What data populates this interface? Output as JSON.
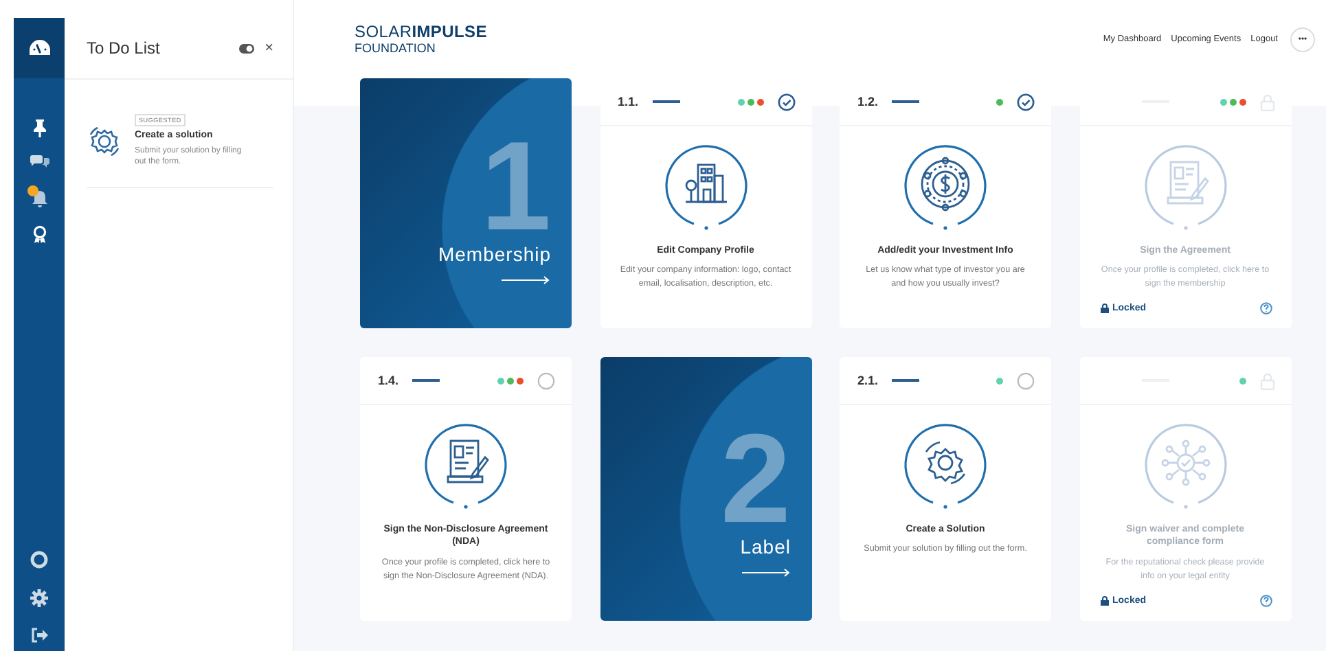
{
  "nav": {
    "top": [
      {
        "kind": "pin"
      },
      {
        "kind": "chat"
      },
      {
        "kind": "bell",
        "badge": true
      },
      {
        "kind": "award"
      }
    ],
    "bottom": [
      {
        "kind": "help"
      },
      {
        "kind": "settings"
      },
      {
        "kind": "logout"
      }
    ]
  },
  "todo": {
    "title": "To Do List",
    "close": "×",
    "items": [
      {
        "tag": "SUGGESTED",
        "title": "Create a solution",
        "description": "Submit your solution by filling out the form."
      }
    ]
  },
  "header": {
    "logo": "SOLAR**IMPULSE**",
    "logo_sub": "FOUNDATION",
    "links": [
      "My Dashboard",
      "Upcoming Events",
      "Logout"
    ],
    "more": "•••"
  },
  "cards": [
    {
      "kind": "section",
      "number": "1",
      "label": "Membership"
    },
    {
      "kind": "building",
      "number": "1.1.",
      "done": true,
      "locked": false,
      "dots": [
        {
          "color": "#5fd3b0"
        },
        {
          "color": "#4cbc5a"
        },
        {
          "color": "#e8502e"
        }
      ],
      "title": "Edit Company Profile",
      "description": "Edit your company information: logo, contact email, localisation, description, etc."
    },
    {
      "kind": "money",
      "number": "1.2.",
      "done": true,
      "locked": false,
      "dots": [
        {
          "color": "#4cbc5a"
        }
      ],
      "title": "Add/edit your Investment Info",
      "description": "Let us know what type of investor you are and how you usually invest?"
    },
    {
      "kind": "document",
      "locked": true,
      "dots": [
        {
          "color": "#5fd3b0"
        },
        {
          "color": "#4cbc5a"
        },
        {
          "color": "#e8502e"
        }
      ],
      "title": "Sign the Agreement",
      "description": "Once your profile is completed, click here to sign the membership",
      "footer": "Locked"
    },
    {
      "kind": "document",
      "number": "1.4.",
      "done": false,
      "locked": false,
      "dots": [
        {
          "color": "#5fd3b0"
        },
        {
          "color": "#4cbc5a"
        },
        {
          "color": "#e8502e"
        }
      ],
      "title": "Sign the Non-Disclosure Agreement (NDA)",
      "description": "Once your profile is completed, click here to sign the Non-Disclosure Agreement (NDA)."
    },
    {
      "kind": "section",
      "number": "2",
      "label": "Label"
    },
    {
      "kind": "gear",
      "number": "2.1.",
      "done": false,
      "locked": false,
      "dots": [
        {
          "color": "#5fd3b0"
        }
      ],
      "title": "Create a Solution",
      "description": "Submit your solution by filling out the form."
    },
    {
      "kind": "network",
      "locked": true,
      "dots": [
        {
          "color": "#5fd3b0"
        }
      ],
      "title": "Sign waiver and complete compliance form",
      "description": "For the reputational check please provide info on your legal entity",
      "footer": "Locked"
    }
  ]
}
